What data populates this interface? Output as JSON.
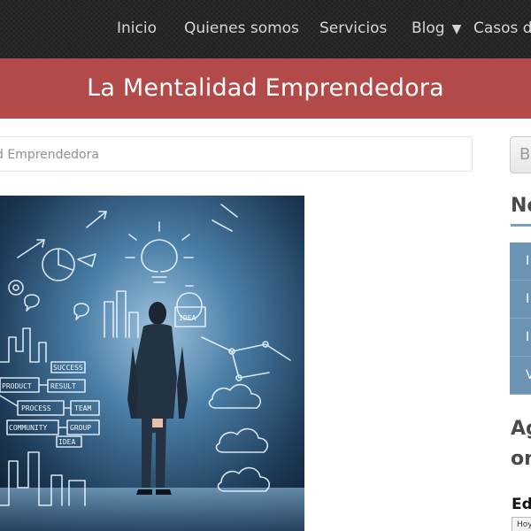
{
  "nav": {
    "items": [
      {
        "label": "Inicio"
      },
      {
        "label": "Quienes somos"
      },
      {
        "label": "Servicios"
      },
      {
        "label": "Blog"
      },
      {
        "label": "Casos de"
      }
    ]
  },
  "banner": {
    "title": "La Mentalidad Emprendedora"
  },
  "breadcrumb": {
    "text": "d Emprendedora"
  },
  "sidebar": {
    "button_label": "B",
    "heading_1": "No",
    "list_items": [
      {
        "label": "I"
      },
      {
        "label": "I"
      },
      {
        "label": "I"
      },
      {
        "label": "V"
      }
    ],
    "heading_2_line_1": "Ag",
    "heading_2_line_2": "on",
    "heading_3": "Ed",
    "mini_box_text": "Hoy"
  },
  "hero": {
    "labels": [
      "SUCCESS",
      "PRODUCT",
      "RESULT",
      "PROCESS",
      "TEAM",
      "COMMUNITY",
      "GROUP",
      "IDEA",
      "IDEA"
    ]
  },
  "colors": {
    "nav_bg": "#262626",
    "banner_bg": "#b24a49",
    "sidebar_blue": "#6b93b3",
    "sidebar_line": "#7aa0c0"
  }
}
